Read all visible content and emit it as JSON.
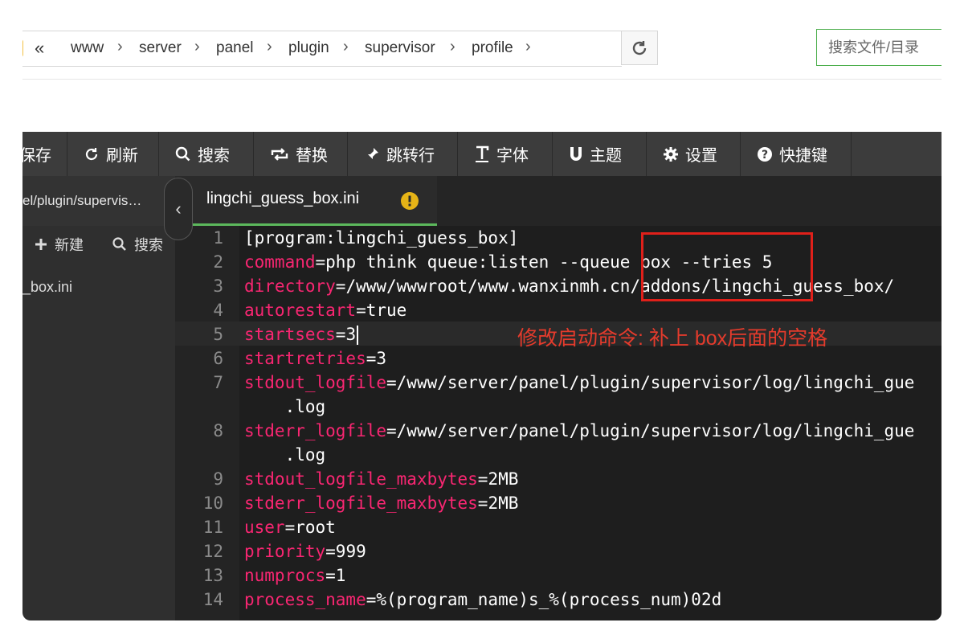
{
  "pathbar": {
    "crumbs": [
      "www",
      "server",
      "panel",
      "plugin",
      "supervisor",
      "profile"
    ],
    "search_placeholder": "搜索文件/目录"
  },
  "toolbar": {
    "items": [
      {
        "label": "保存",
        "icon": "save-icon"
      },
      {
        "label": "刷新",
        "icon": "refresh-icon"
      },
      {
        "label": "搜索",
        "icon": "search-icon"
      },
      {
        "label": "替换",
        "icon": "replace-icon"
      },
      {
        "label": "跳转行",
        "icon": "pin-icon"
      },
      {
        "label": "字体",
        "icon": "font-icon"
      },
      {
        "label": "主题",
        "icon": "magnet-icon"
      },
      {
        "label": "设置",
        "icon": "gear-icon"
      },
      {
        "label": "快捷键",
        "icon": "help-icon"
      }
    ]
  },
  "sidebar": {
    "path": "el/plugin/supervis…",
    "new_label": "新建",
    "search_label": "搜索",
    "file": "_box.ini"
  },
  "editor": {
    "tab_title": "lingchi_guess_box.ini",
    "lines": [
      {
        "n": "1",
        "key": "",
        "rest": "[program:lingchi_guess_box]"
      },
      {
        "n": "2",
        "key": "command",
        "rest": "=php think queue:listen --queue box --tries 5"
      },
      {
        "n": "3",
        "key": "directory",
        "rest": "=/www/wwwroot/www.wanxinmh.cn/addons/lingchi_guess_box/"
      },
      {
        "n": "4",
        "key": "autorestart",
        "rest": "=true"
      },
      {
        "n": "5",
        "key": "startsecs",
        "rest": "=3"
      },
      {
        "n": "6",
        "key": "startretries",
        "rest": "=3"
      },
      {
        "n": "7",
        "key": "stdout_logfile",
        "rest": "=/www/server/panel/plugin/supervisor/log/lingchi_gue",
        "cont": "    .log"
      },
      {
        "n": "8",
        "key": "stderr_logfile",
        "rest": "=/www/server/panel/plugin/supervisor/log/lingchi_gue",
        "cont": "    .log"
      },
      {
        "n": "9",
        "key": "stdout_logfile_maxbytes",
        "rest": "=2MB"
      },
      {
        "n": "10",
        "key": "stderr_logfile_maxbytes",
        "rest": "=2MB"
      },
      {
        "n": "11",
        "key": "user",
        "rest": "=root"
      },
      {
        "n": "12",
        "key": "priority",
        "rest": "=999"
      },
      {
        "n": "13",
        "key": "numprocs",
        "rest": "=1"
      },
      {
        "n": "14",
        "key": "process_name",
        "rest": "=%(program_name)s_%(process_num)02d"
      }
    ],
    "annotation": "修改启动命令: 补上 box后面的空格"
  },
  "colors": {
    "key": "#f92672",
    "accent": "#5cb85c",
    "annotation": "#e53b2c",
    "warning": "#e6b417"
  }
}
